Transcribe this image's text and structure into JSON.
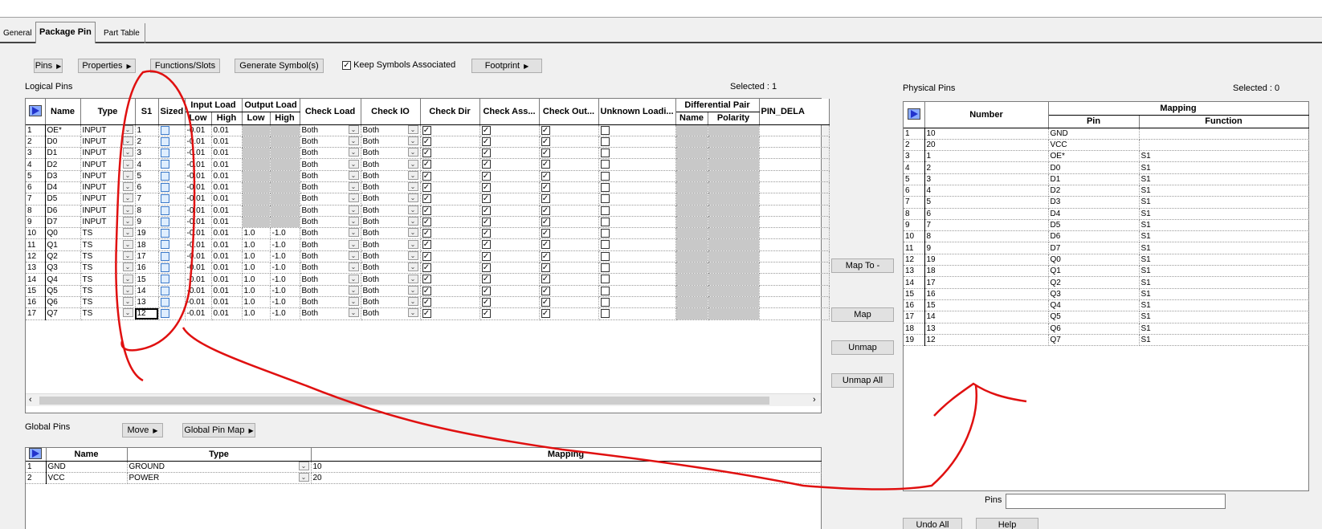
{
  "tabs": [
    "General",
    "Package Pin",
    "Part Table"
  ],
  "toolbar": {
    "pins": "Pins",
    "properties": "Properties",
    "functions": "Functions/Slots",
    "generate": "Generate Symbol(s)",
    "keep": "Keep Symbols Associated",
    "footprint": "Footprint"
  },
  "logical": {
    "title": "Logical Pins",
    "selected": "Selected :  1",
    "headers": {
      "name": "Name",
      "type": "Type",
      "s1": "S1",
      "sized": "Sized",
      "input_load": "Input Load",
      "output_load": "Output Load",
      "low": "Low",
      "high": "High",
      "check_load": "Check Load",
      "check_io": "Check IO",
      "check_dir": "Check Dir",
      "check_ass": "Check Ass...",
      "check_out": "Check Out...",
      "unknown": "Unknown Loadi...",
      "diff": "Differential Pair",
      "diff_name": "Name",
      "diff_pol": "Polarity",
      "pin_del": "PIN_DELA"
    },
    "rows": [
      {
        "n": "1",
        "name": "OE*",
        "type": "INPUT",
        "s1": "1",
        "il": "-0.01",
        "ih": "0.01",
        "ol": "",
        "oh": "",
        "cl": "Both",
        "cio": "Both"
      },
      {
        "n": "2",
        "name": "D0",
        "type": "INPUT",
        "s1": "2",
        "il": "-0.01",
        "ih": "0.01",
        "ol": "",
        "oh": "",
        "cl": "Both",
        "cio": "Both"
      },
      {
        "n": "3",
        "name": "D1",
        "type": "INPUT",
        "s1": "3",
        "il": "-0.01",
        "ih": "0.01",
        "ol": "",
        "oh": "",
        "cl": "Both",
        "cio": "Both"
      },
      {
        "n": "4",
        "name": "D2",
        "type": "INPUT",
        "s1": "4",
        "il": "-0.01",
        "ih": "0.01",
        "ol": "",
        "oh": "",
        "cl": "Both",
        "cio": "Both"
      },
      {
        "n": "5",
        "name": "D3",
        "type": "INPUT",
        "s1": "5",
        "il": "-0.01",
        "ih": "0.01",
        "ol": "",
        "oh": "",
        "cl": "Both",
        "cio": "Both"
      },
      {
        "n": "6",
        "name": "D4",
        "type": "INPUT",
        "s1": "6",
        "il": "-0.01",
        "ih": "0.01",
        "ol": "",
        "oh": "",
        "cl": "Both",
        "cio": "Both"
      },
      {
        "n": "7",
        "name": "D5",
        "type": "INPUT",
        "s1": "7",
        "il": "-0.01",
        "ih": "0.01",
        "ol": "",
        "oh": "",
        "cl": "Both",
        "cio": "Both"
      },
      {
        "n": "8",
        "name": "D6",
        "type": "INPUT",
        "s1": "8",
        "il": "-0.01",
        "ih": "0.01",
        "ol": "",
        "oh": "",
        "cl": "Both",
        "cio": "Both"
      },
      {
        "n": "9",
        "name": "D7",
        "type": "INPUT",
        "s1": "9",
        "il": "-0.01",
        "ih": "0.01",
        "ol": "",
        "oh": "",
        "cl": "Both",
        "cio": "Both"
      },
      {
        "n": "10",
        "name": "Q0",
        "type": "TS",
        "s1": "19",
        "il": "-0.01",
        "ih": "0.01",
        "ol": "1.0",
        "oh": "-1.0",
        "cl": "Both",
        "cio": "Both"
      },
      {
        "n": "11",
        "name": "Q1",
        "type": "TS",
        "s1": "18",
        "il": "-0.01",
        "ih": "0.01",
        "ol": "1.0",
        "oh": "-1.0",
        "cl": "Both",
        "cio": "Both"
      },
      {
        "n": "12",
        "name": "Q2",
        "type": "TS",
        "s1": "17",
        "il": "-0.01",
        "ih": "0.01",
        "ol": "1.0",
        "oh": "-1.0",
        "cl": "Both",
        "cio": "Both"
      },
      {
        "n": "13",
        "name": "Q3",
        "type": "TS",
        "s1": "16",
        "il": "-0.01",
        "ih": "0.01",
        "ol": "1.0",
        "oh": "-1.0",
        "cl": "Both",
        "cio": "Both"
      },
      {
        "n": "14",
        "name": "Q4",
        "type": "TS",
        "s1": "15",
        "il": "-0.01",
        "ih": "0.01",
        "ol": "1.0",
        "oh": "-1.0",
        "cl": "Both",
        "cio": "Both"
      },
      {
        "n": "15",
        "name": "Q5",
        "type": "TS",
        "s1": "14",
        "il": "-0.01",
        "ih": "0.01",
        "ol": "1.0",
        "oh": "-1.0",
        "cl": "Both",
        "cio": "Both"
      },
      {
        "n": "16",
        "name": "Q6",
        "type": "TS",
        "s1": "13",
        "il": "-0.01",
        "ih": "0.01",
        "ol": "1.0",
        "oh": "-1.0",
        "cl": "Both",
        "cio": "Both"
      },
      {
        "n": "17",
        "name": "Q7",
        "type": "TS",
        "s1": "12",
        "il": "-0.01",
        "ih": "0.01",
        "ol": "1.0",
        "oh": "-1.0",
        "cl": "Both",
        "cio": "Both"
      }
    ]
  },
  "global": {
    "title": "Global Pins",
    "move": "Move",
    "map": "Global Pin Map",
    "headers": {
      "name": "Name",
      "type": "Type",
      "mapping": "Mapping"
    },
    "rows": [
      {
        "n": "1",
        "name": "GND",
        "type": "GROUND",
        "map": "10"
      },
      {
        "n": "2",
        "name": "VCC",
        "type": "POWER",
        "map": "20"
      }
    ]
  },
  "mid": {
    "map_to": "Map To -",
    "map": "Map",
    "unmap": "Unmap",
    "unmap_all": "Unmap All"
  },
  "physical": {
    "title": "Physical Pins",
    "selected": "Selected :  0",
    "headers": {
      "number": "Number",
      "mapping": "Mapping",
      "pin": "Pin",
      "function": "Function"
    },
    "rows": [
      {
        "n": "1",
        "num": "10",
        "pin": "GND",
        "fn": ""
      },
      {
        "n": "2",
        "num": "20",
        "pin": "VCC",
        "fn": ""
      },
      {
        "n": "3",
        "num": "1",
        "pin": "OE*",
        "fn": "S1"
      },
      {
        "n": "4",
        "num": "2",
        "pin": "D0",
        "fn": "S1"
      },
      {
        "n": "5",
        "num": "3",
        "pin": "D1",
        "fn": "S1"
      },
      {
        "n": "6",
        "num": "4",
        "pin": "D2",
        "fn": "S1"
      },
      {
        "n": "7",
        "num": "5",
        "pin": "D3",
        "fn": "S1"
      },
      {
        "n": "8",
        "num": "6",
        "pin": "D4",
        "fn": "S1"
      },
      {
        "n": "9",
        "num": "7",
        "pin": "D5",
        "fn": "S1"
      },
      {
        "n": "10",
        "num": "8",
        "pin": "D6",
        "fn": "S1"
      },
      {
        "n": "11",
        "num": "9",
        "pin": "D7",
        "fn": "S1"
      },
      {
        "n": "12",
        "num": "19",
        "pin": "Q0",
        "fn": "S1"
      },
      {
        "n": "13",
        "num": "18",
        "pin": "Q1",
        "fn": "S1"
      },
      {
        "n": "14",
        "num": "17",
        "pin": "Q2",
        "fn": "S1"
      },
      {
        "n": "15",
        "num": "16",
        "pin": "Q3",
        "fn": "S1"
      },
      {
        "n": "16",
        "num": "15",
        "pin": "Q4",
        "fn": "S1"
      },
      {
        "n": "17",
        "num": "14",
        "pin": "Q5",
        "fn": "S1"
      },
      {
        "n": "18",
        "num": "13",
        "pin": "Q6",
        "fn": "S1"
      },
      {
        "n": "19",
        "num": "12",
        "pin": "Q7",
        "fn": "S1"
      }
    ]
  },
  "pins_label": "Pins",
  "pins_value": "",
  "bottom": {
    "undo_all": "Undo All",
    "help": "Help"
  },
  "colors": {
    "annotation": "#e01010"
  }
}
